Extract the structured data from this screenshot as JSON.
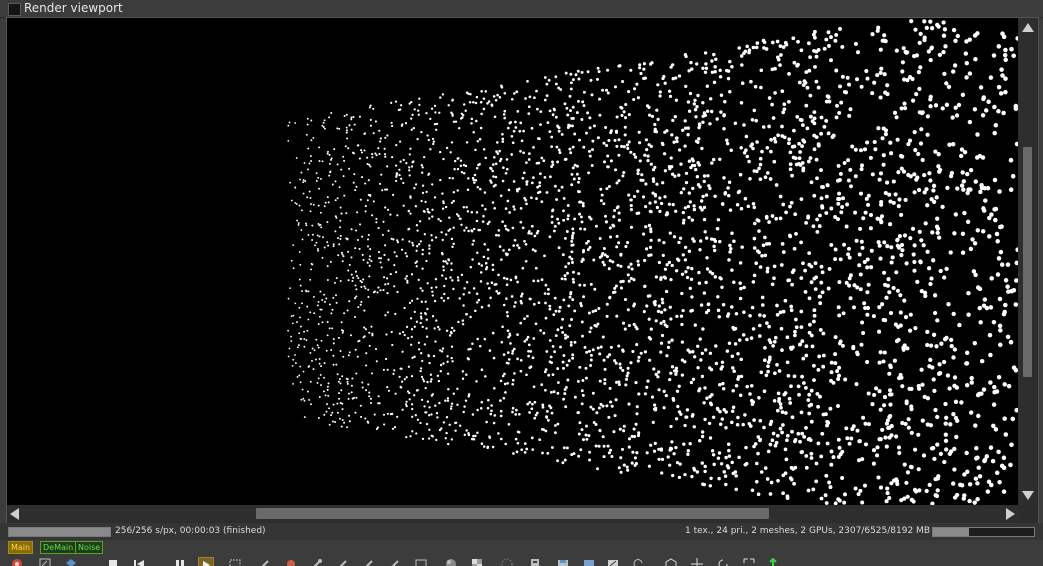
{
  "window": {
    "title": "Render viewport"
  },
  "status": {
    "left_text": "256/256 s/px, 00:00:03 (finished)",
    "right_text": "1 tex., 24 pri., 2 meshes, 2 GPUs, 2307/6525/8192 MB",
    "render_progress": 1.0,
    "memory_usage": 0.354
  },
  "passes": [
    {
      "label": "Main",
      "state": "active"
    },
    {
      "label": "DeMain",
      "state": "inactive"
    },
    {
      "label": "Noise",
      "state": "inactive"
    }
  ],
  "toolbar": {
    "icons": [
      "render-target-icon",
      "export-icon",
      "layer-icon",
      "stop-icon",
      "restart-icon",
      "pause-icon",
      "start-icon",
      "region-icon",
      "picker-icon",
      "material-picker-icon",
      "object-picker-icon",
      "focus-picker-icon",
      "white-balance-icon",
      "crop-icon",
      "world-icon",
      "clay-icon",
      "subsampling-icon",
      "copy-icon",
      "save-icon",
      "save-all-icon",
      "settings-icon",
      "undo-icon",
      "cube-icon",
      "move-icon",
      "rotate-icon",
      "fullscreen-icon",
      "up-arrow-icon"
    ],
    "play_state": "playing"
  },
  "colors": {
    "pass_active_bg": "#8a6d00",
    "pass_active_text": "#ffd84a",
    "pass_inactive_text": "#5ee04a",
    "viewport_bg": "#000000",
    "particle": "#ffffff"
  }
}
